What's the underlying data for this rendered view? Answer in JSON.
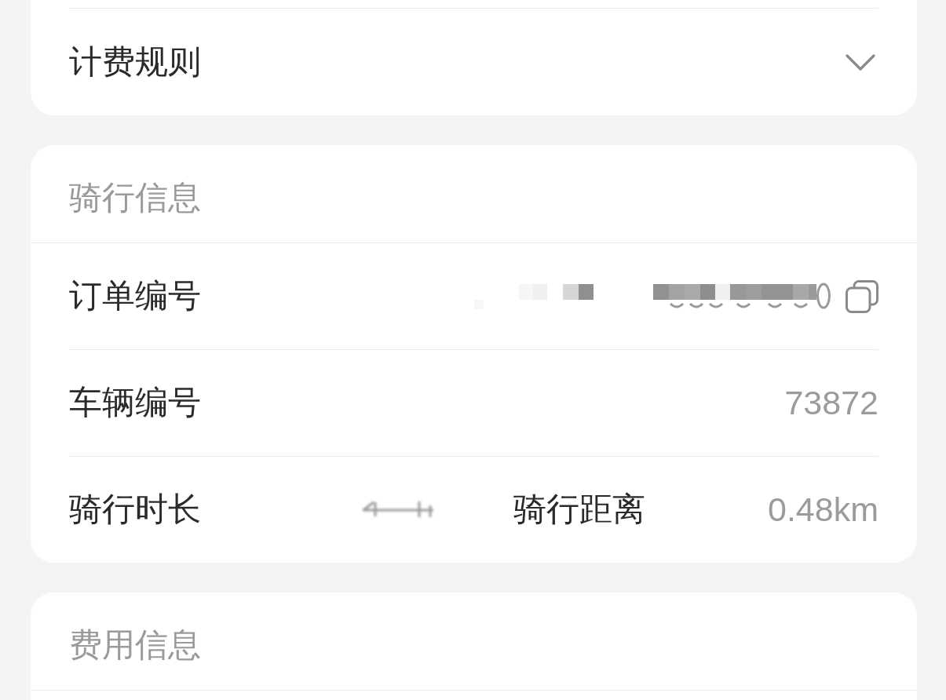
{
  "sections": [
    {
      "kind": "collapsible",
      "title": "计费规则",
      "expanded": false
    },
    {
      "kind": "info",
      "title": "骑行信息",
      "rows": [
        {
          "kind": "single",
          "label": "订单编号",
          "value": {
            "kind": "pixelated"
          },
          "copyable": true
        },
        {
          "kind": "single",
          "label": "车辆编号",
          "value": {
            "kind": "text",
            "text": "73872"
          }
        },
        {
          "kind": "pair",
          "items": [
            {
              "label": "骑行时长",
              "value": {
                "kind": "blurred"
              }
            },
            {
              "label": "骑行距离",
              "value": {
                "kind": "text",
                "text": "0.48km"
              }
            }
          ]
        }
      ]
    },
    {
      "kind": "info",
      "title": "费用信息"
    }
  ]
}
